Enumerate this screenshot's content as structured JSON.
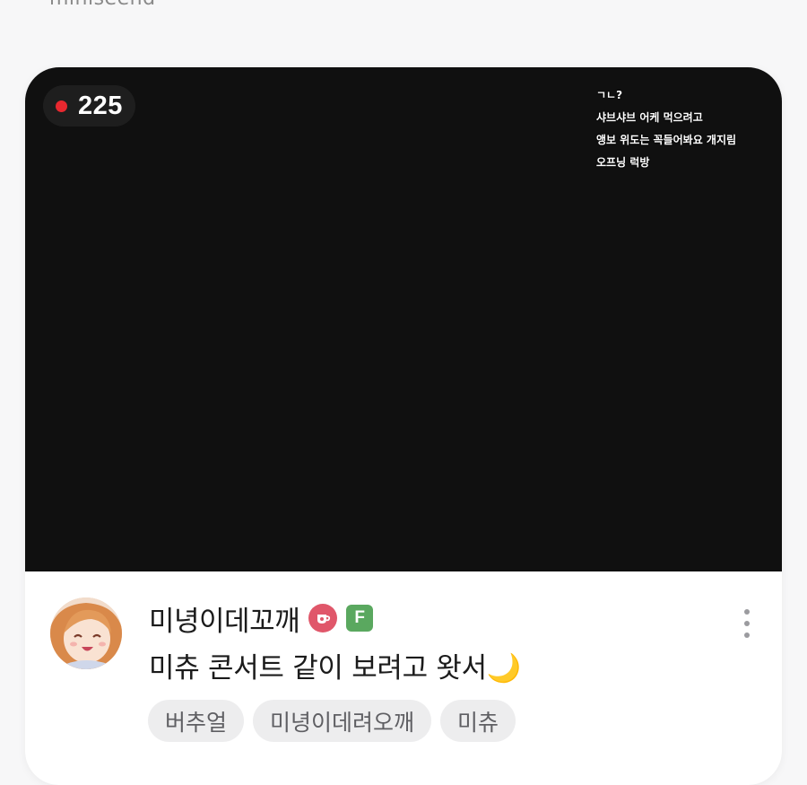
{
  "top_cut_text": "miniseend",
  "stream": {
    "viewer_count": "225",
    "chat_lines": [
      "ㄱㄴ?",
      "샤브샤브 어케 먹으려고",
      "앵보 위도는 꼭들어봐요 개지림",
      "오프닝 럭방"
    ]
  },
  "streamer": {
    "name": "미녕이데꼬깨",
    "badge_f": "F"
  },
  "title": "미츄 콘서트 같이 보려고 왓서🌙",
  "tags": [
    "버추얼",
    "미녕이데려오깨",
    "미츄"
  ],
  "colors": {
    "live_dot": "#e8282f",
    "red_badge": "#e0576a",
    "green_badge": "#5aa85f"
  }
}
